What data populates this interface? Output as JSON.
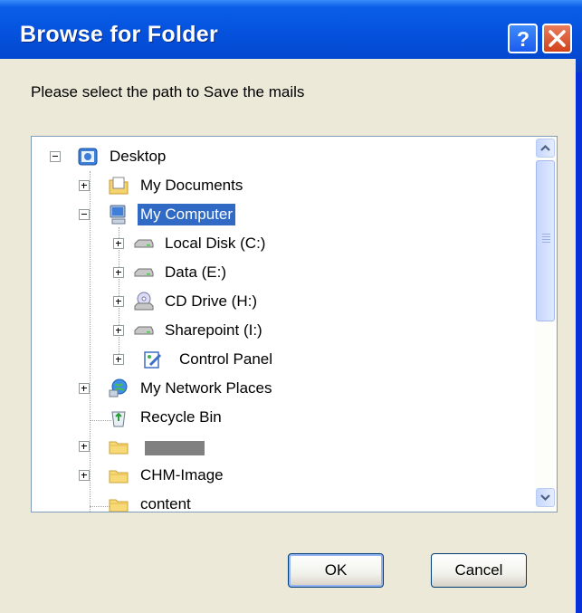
{
  "window": {
    "title": "Browse for Folder",
    "prompt": "Please select the path to Save the mails"
  },
  "title_buttons": {
    "help": "?",
    "close": "×"
  },
  "tree": {
    "items": [
      {
        "label": "Desktop",
        "icon": "desktop-icon",
        "expander": "minus"
      },
      {
        "label": "My Documents",
        "icon": "my-documents-icon",
        "expander": "plus"
      },
      {
        "label": "My Computer",
        "icon": "my-computer-icon",
        "expander": "minus",
        "selected": true
      },
      {
        "label": "Local Disk (C:)",
        "icon": "hard-drive-icon",
        "expander": "plus"
      },
      {
        "label": "Data (E:)",
        "icon": "hard-drive-icon",
        "expander": "plus"
      },
      {
        "label": "CD Drive (H:)",
        "icon": "cd-drive-icon",
        "expander": "plus"
      },
      {
        "label": "Sharepoint  (I:)",
        "icon": "network-drive-icon",
        "expander": "plus"
      },
      {
        "label": "Control Panel",
        "icon": "control-panel-icon",
        "expander": "plus"
      },
      {
        "label": "My Network Places",
        "icon": "network-places-icon",
        "expander": "plus"
      },
      {
        "label": "Recycle Bin",
        "icon": "recycle-bin-icon",
        "expander": "none"
      },
      {
        "label": "",
        "icon": "folder-icon",
        "expander": "plus",
        "redacted": true
      },
      {
        "label": "CHM-Image",
        "icon": "folder-icon",
        "expander": "plus"
      },
      {
        "label": "content",
        "icon": "folder-icon",
        "expander": "none"
      }
    ]
  },
  "buttons": {
    "ok": "OK",
    "cancel": "Cancel"
  },
  "colors": {
    "selection": "#316ac5",
    "titlebar": "#0552dd",
    "dialog_bg": "#ece9d8"
  }
}
